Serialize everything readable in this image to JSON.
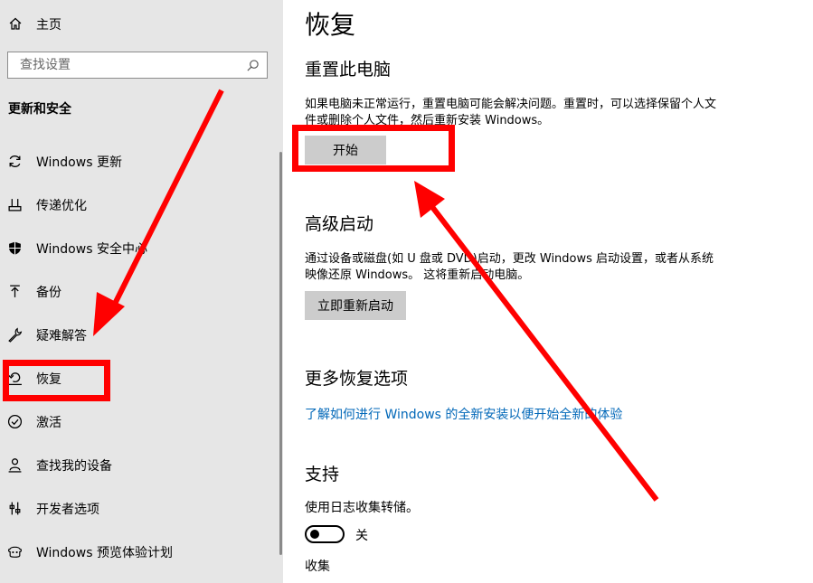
{
  "sidebar": {
    "home_label": "主页",
    "search_placeholder": "查找设置",
    "section_title": "更新和安全",
    "items": [
      {
        "label": "Windows 更新",
        "icon": "refresh-icon"
      },
      {
        "label": "传递优化",
        "icon": "delivery-optimization-icon"
      },
      {
        "label": "Windows 安全中心",
        "icon": "shield-icon"
      },
      {
        "label": "备份",
        "icon": "backup-arrow-icon"
      },
      {
        "label": "疑难解答",
        "icon": "wrench-icon"
      },
      {
        "label": "恢复",
        "icon": "recovery-icon"
      },
      {
        "label": "激活",
        "icon": "check-circle-icon"
      },
      {
        "label": "查找我的设备",
        "icon": "person-location-icon"
      },
      {
        "label": "开发者选项",
        "icon": "developer-icon"
      },
      {
        "label": "Windows 预览体验计划",
        "icon": "insider-icon"
      }
    ]
  },
  "main": {
    "title": "恢复",
    "reset": {
      "heading": "重置此电脑",
      "description": "如果电脑未正常运行，重置电脑可能会解决问题。重置时，可以选择保留个人文件或删除个人文件，然后重新安装 Windows。",
      "button": "开始"
    },
    "advanced": {
      "heading": "高级启动",
      "description": "通过设备或磁盘(如 U 盘或 DVD)启动，更改 Windows 启动设置，或者从系统映像还原 Windows。 这将重新启动电脑。",
      "button": "立即重新启动"
    },
    "more": {
      "heading": "更多恢复选项",
      "link": "了解如何进行 Windows 的全新安装以便开始全新的体验"
    },
    "support": {
      "heading": "支持",
      "log_label": "使用日志收集转储。",
      "toggle_state": "关",
      "collect_label": "收集"
    }
  },
  "colors": {
    "sidebar_bg": "#e6e6e6",
    "button_bg": "#cccccc",
    "link": "#0067b8",
    "annotation": "#ff0000"
  }
}
